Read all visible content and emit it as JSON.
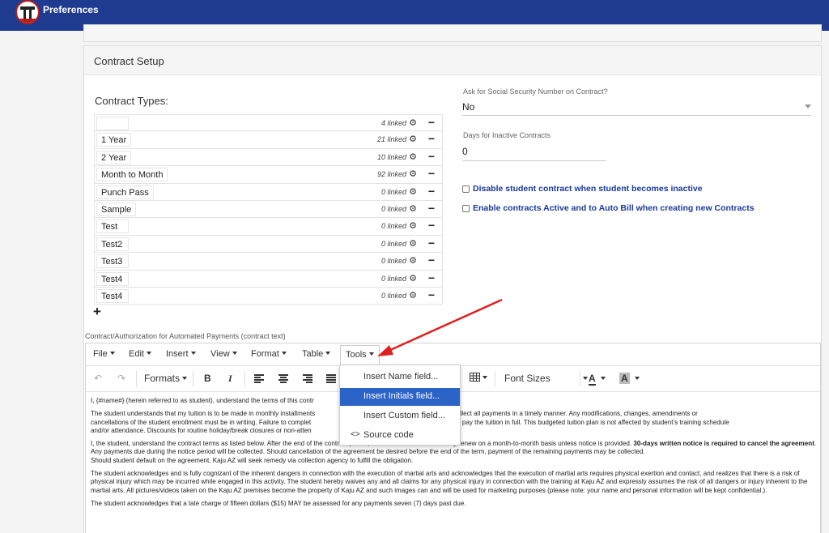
{
  "header": {
    "title": "Preferences"
  },
  "section": {
    "title": "Contract Setup"
  },
  "contract_types": {
    "label": "Contract Types:",
    "rows": [
      {
        "name": "",
        "linked": "4 linked"
      },
      {
        "name": "1 Year",
        "linked": "21 linked"
      },
      {
        "name": "2 Year",
        "linked": "10 linked"
      },
      {
        "name": "Month to Month",
        "linked": "92 linked"
      },
      {
        "name": "Punch Pass",
        "linked": "0 linked"
      },
      {
        "name": "Sample",
        "linked": "0 linked"
      },
      {
        "name": "Test",
        "linked": "0 linked"
      },
      {
        "name": "Test2",
        "linked": "0 linked"
      },
      {
        "name": "Test3",
        "linked": "0 linked"
      },
      {
        "name": "Test4",
        "linked": "0 linked"
      },
      {
        "name": "Test4",
        "linked": "0 linked"
      }
    ],
    "add_symbol": "+",
    "remove_symbol": "−",
    "gear_symbol": "⚙"
  },
  "ssn": {
    "label": "Ask for Social Security Number on Contract?",
    "value": "No"
  },
  "inactive_days": {
    "label": "Days for Inactive Contracts",
    "value": "0"
  },
  "checkboxes": {
    "disable_inactive": "Disable student contract when student becomes inactive",
    "auto_bill": "Enable contracts Active and to Auto Bill when creating new Contracts"
  },
  "editor": {
    "label": "Contract/Authorization for Automated Payments (contract text)",
    "menu": [
      "File",
      "Edit",
      "Insert",
      "View",
      "Format",
      "Table",
      "Tools"
    ],
    "toolbar": {
      "undo": "↶",
      "redo": "↷",
      "formats": "Formats",
      "bold": "B",
      "italic": "I",
      "font_sizes": "Font Sizes",
      "text_color": "A",
      "bg_color": "A"
    },
    "tools_menu": {
      "items": [
        "Insert Name field...",
        "Insert Initials field...",
        "Insert Custom field..."
      ],
      "source_code_icon": "<>",
      "source_code": "Source code"
    },
    "content": {
      "p1": "I, {#name#} (herein referred to as student), understand the terms of this contr",
      "p2a": "The student understands that my tuition is to be made in monthly installments",
      "p2b": "sponsibility to collect all payments in a timely manner.  Any modifications, changes, amendments or",
      "p2c": "cancellations of the student enrollment must be in writing.  Failure to complet",
      "p2d": "ny obligation to pay the tuition in full.  This budgeted tuition plan is not affected by student’s training schedule",
      "p2e": "and/or attendance.  Discounts for routine holiday/break closures or non-atten",
      "p3a": "I, the student, understand the contract terms as listed below. After the end of the contract period, the contract will automatically renew on a month-to-month basis unless notice is provided.",
      "p3bold": "30-days written notice is required to cancel the agreement",
      "p3b": ".  Any payments due during the notice period will be collected.  Should cancellation of the agreement be desired before the end of the term, payment of the remaining payments may be collected.",
      "p3c": "Should student default on the agreement, Kaju AZ will seek remedy via collection agency to fulfill the obligation.",
      "p4": "The student acknowledges and is fully cognizant of the inherent dangers in connection with the execution of martial arts and acknowledges that the execution of martial arts requires physical exertion and contact, and realizes that there is a risk of physical injury which may be incurred while engaged in this activity. The student hereby waives any and all claims for any physical injury in connection with the training at Kaju AZ and expressly assumes the risk of all dangers or injury inherent to the martial arts.  All pictures/videos taken on the Kaju AZ premises become the property of Kaju AZ and such images can and will be used for marketing purposes (please note: your name and personal information will be kept confidential.).",
      "p5": "The student acknowledges that a late charge of fifteen dollars ($15) MAY be assessed for any payments seven (7) days past due."
    }
  },
  "colors": {
    "topbar": "#1f3b8f",
    "highlight": "#2c63c7",
    "checkbox_text": "#1a3a9c",
    "arrow": "#e02020"
  }
}
